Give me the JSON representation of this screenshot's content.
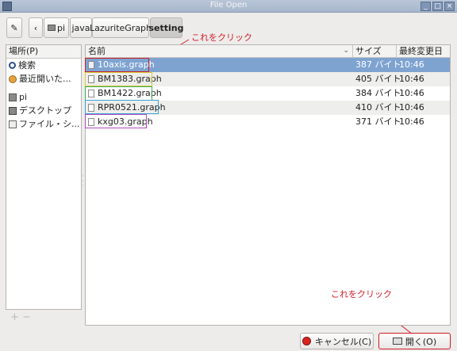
{
  "window": {
    "title": "File Open"
  },
  "pathbar": {
    "crumbs": [
      "pi",
      "java",
      "LazuriteGraph",
      "setting"
    ]
  },
  "places": {
    "header": "場所(P)",
    "items": [
      {
        "label": "検索",
        "icon": "search-icon"
      },
      {
        "label": "最近開いた...",
        "icon": "recent-icon"
      },
      {
        "label": "pi",
        "icon": "home-folder-icon"
      },
      {
        "label": "デスクトップ",
        "icon": "desktop-icon"
      },
      {
        "label": "ファイル・シ...",
        "icon": "filesystem-icon"
      }
    ]
  },
  "files": {
    "headers": {
      "name": "名前",
      "size": "サイズ",
      "modified": "最終変更日"
    },
    "rows": [
      {
        "name": "10axis.graph",
        "size": "387 バイト",
        "modified": "10:46",
        "selected": true
      },
      {
        "name": "BM1383.graph",
        "size": "405 バイト",
        "modified": "10:46",
        "selected": false
      },
      {
        "name": "BM1422.graph",
        "size": "384 バイト",
        "modified": "10:46",
        "selected": false
      },
      {
        "name": "RPR0521.graph",
        "size": "410 バイト",
        "modified": "10:46",
        "selected": false
      },
      {
        "name": "kxg03.graph",
        "size": "371 バイト",
        "modified": "10:46",
        "selected": false
      }
    ]
  },
  "annotations": {
    "top": "これをクリック",
    "bottom": "これをクリック",
    "color": "#d11b24"
  },
  "buttons": {
    "cancel": "キャンセル(C)",
    "open": "開く(O)"
  },
  "colors": {
    "selection": "#7ea3d0",
    "titlebar": "#b9c6d8"
  }
}
